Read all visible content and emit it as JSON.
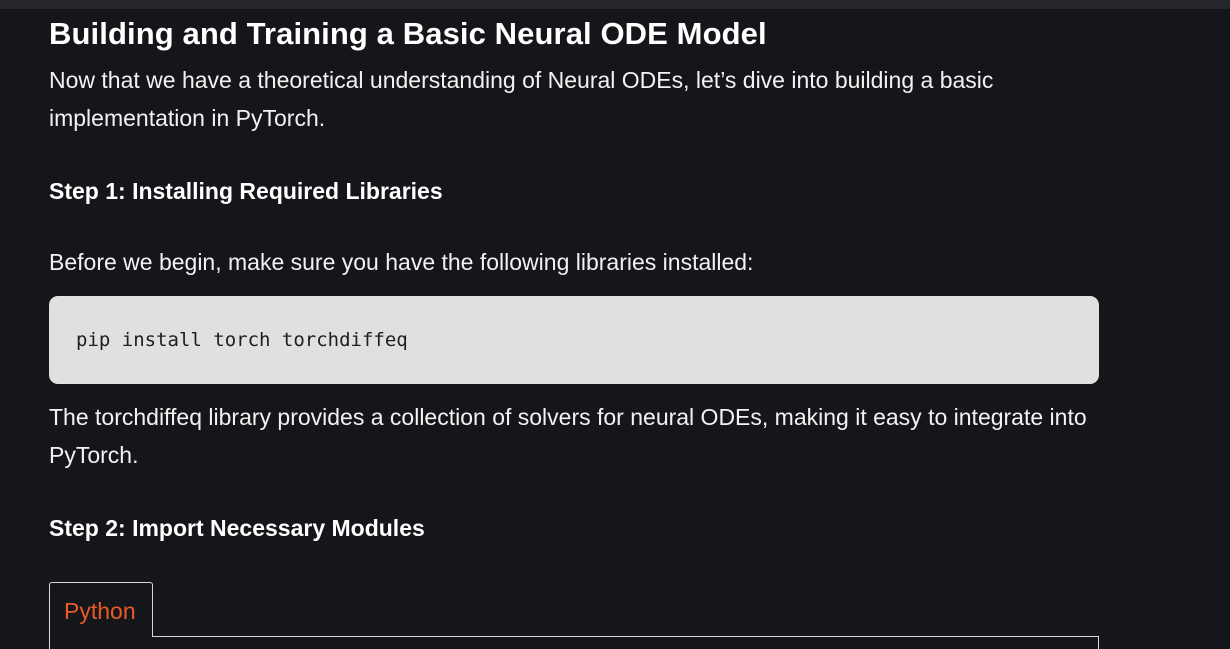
{
  "article": {
    "heading": "Building and Training a Basic Neural ODE Model",
    "intro": "Now that we have a theoretical understanding of Neural ODEs, let’s dive into building a basic implementation in PyTorch.",
    "step1_heading": "Step 1: Installing Required Libraries",
    "step1_text": "Before we begin, make sure you have the following libraries installed:",
    "step1_code": "pip install torch torchdiffeq",
    "step1_note": "The torchdiffeq library provides a collection of solvers for neural ODEs, making it easy to integrate into PyTorch.",
    "step2_heading": "Step 2: Import Necessary Modules"
  },
  "code_tabs": {
    "active_tab": "Python",
    "active_color": "#ea5a28"
  }
}
